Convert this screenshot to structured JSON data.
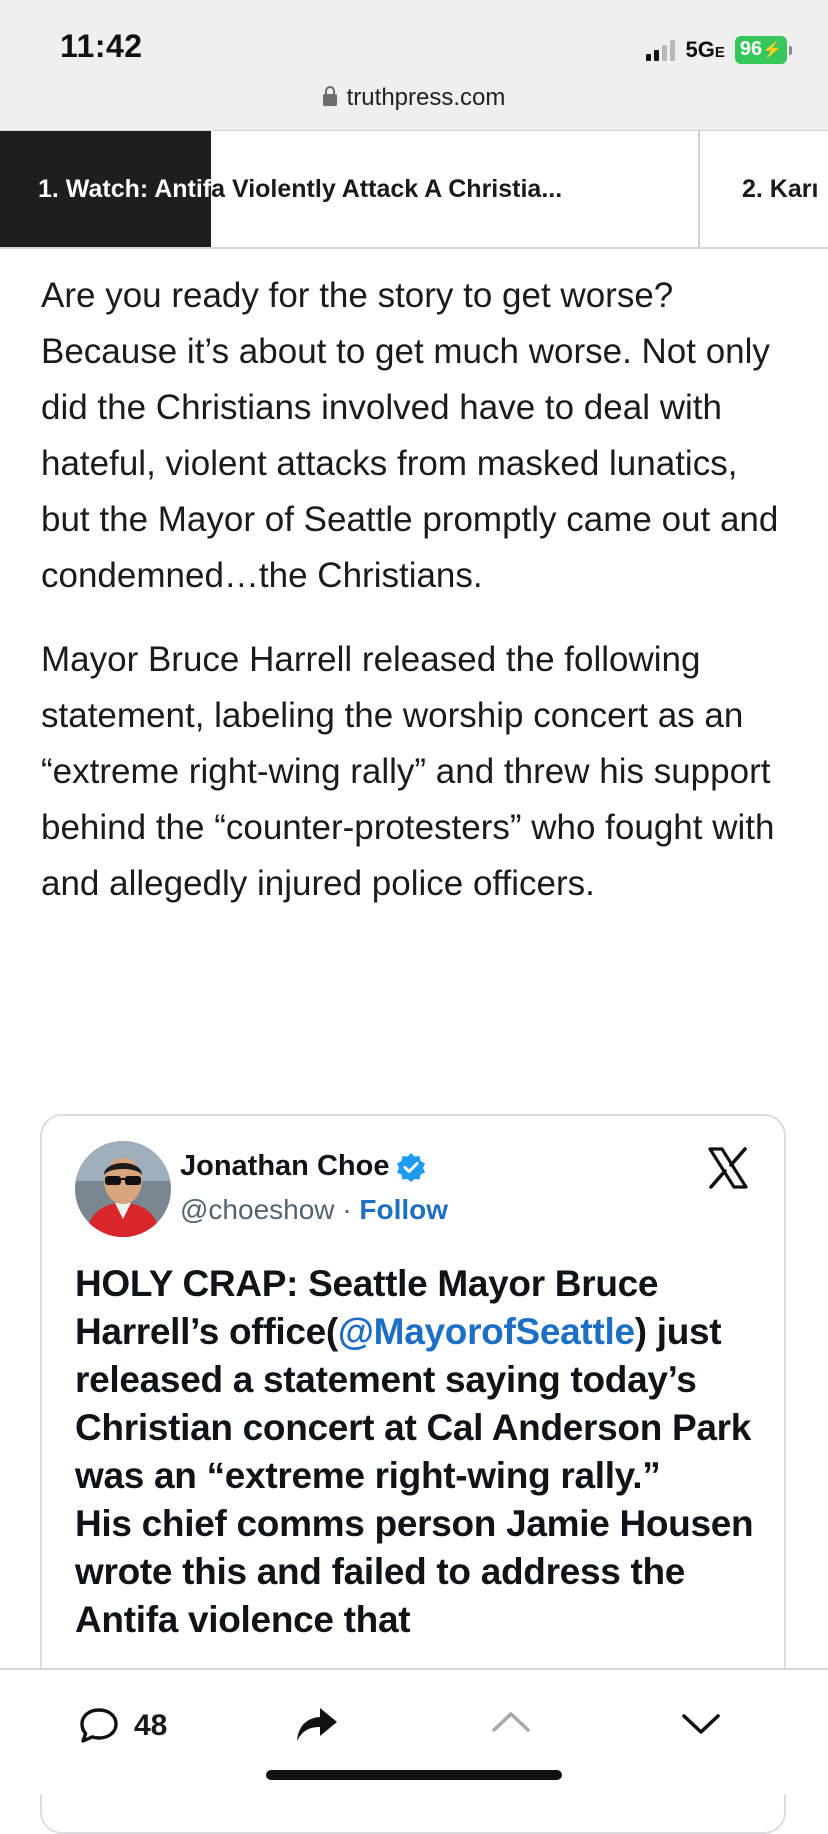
{
  "status_bar": {
    "time": "11:42",
    "network": "5G",
    "network_suffix": "E",
    "battery": "96"
  },
  "browser": {
    "url": "truthpress.com"
  },
  "stories": [
    {
      "label": "1. Watch: Antifa Violently Attack A Christia..."
    },
    {
      "label": "2. Karı"
    }
  ],
  "article": {
    "paragraphs": [
      "Are you ready for the story to get worse? Because it’s about to get much worse. Not only did the Christians involved have to deal with hateful, violent attacks from masked lunatics, but the Mayor of Seattle promptly came out and condemned…the Christians.",
      "Mayor Bruce Harrell released the following statement, labeling the worship concert as an “extreme right-wing rally” and threw his support behind the “counter-protesters” who fought with and allegedly injured police officers."
    ]
  },
  "tweet": {
    "author": "Jonathan Choe",
    "handle": "@choeshow",
    "separator": " · ",
    "follow": "Follow",
    "text_before": "HOLY CRAP: Seattle Mayor Bruce Harrell’s office(",
    "mention": "@MayorofSeattle",
    "text_after": ") just released a statement saying today’s Christian concert at Cal Anderson Park was an “extreme right-wing rally.”",
    "text_line2": "His chief comms person Jamie Housen wrote this and failed to address the Antifa violence that"
  },
  "toolbar": {
    "comment_count": "48"
  }
}
